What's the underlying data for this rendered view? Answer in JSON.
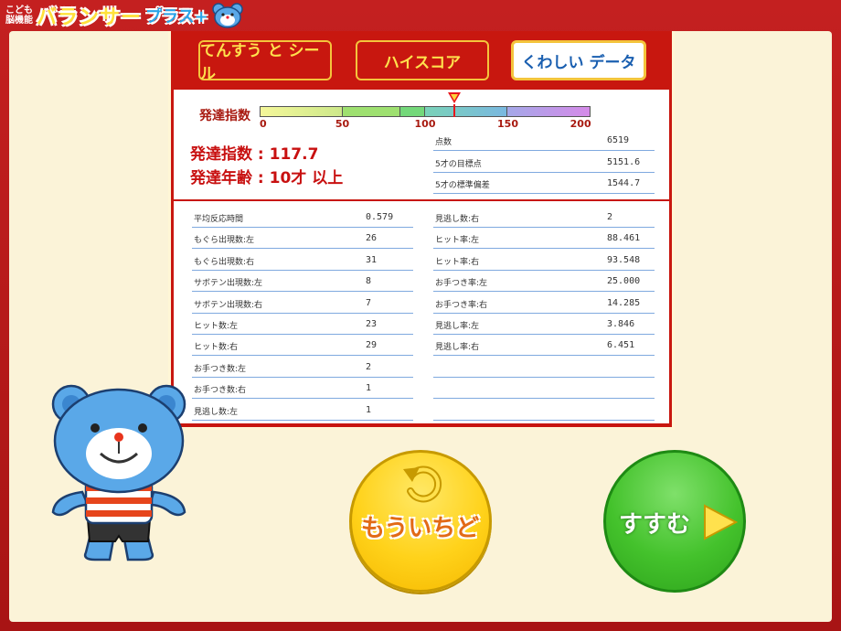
{
  "header": {
    "logo_small_line1": "こども",
    "logo_small_line2": "脳機能",
    "logo_title": "バランサー",
    "logo_plus": "プラス+"
  },
  "tabs": [
    {
      "label": "てんすう と シール",
      "active": false
    },
    {
      "label": "ハイスコア",
      "active": false
    },
    {
      "label": "くわしい データ",
      "active": true
    }
  ],
  "development": {
    "scale_label": "発達指数",
    "scale_ticks": [
      "0",
      "50",
      "100",
      "150",
      "200"
    ],
    "marker_value": 117.7,
    "dq_line": "発達指数 : 117.7",
    "age_line": "発達年齢 : 10才 以上"
  },
  "summary": [
    {
      "label": "点数",
      "value": "6519"
    },
    {
      "label": "5才の目標点",
      "value": "5151.6"
    },
    {
      "label": "5才の標準偏差",
      "value": "1544.7"
    }
  ],
  "stats_left": [
    {
      "label": "平均反応時間",
      "value": "0.579"
    },
    {
      "label": "もぐら出現数:左",
      "value": "26"
    },
    {
      "label": "もぐら出現数:右",
      "value": "31"
    },
    {
      "label": "サボテン出現数:左",
      "value": "8"
    },
    {
      "label": "サボテン出現数:右",
      "value": "7"
    },
    {
      "label": "ヒット数:左",
      "value": "23"
    },
    {
      "label": "ヒット数:右",
      "value": "29"
    },
    {
      "label": "お手つき数:左",
      "value": "2"
    },
    {
      "label": "お手つき数:右",
      "value": "1"
    },
    {
      "label": "見逃し数:左",
      "value": "1"
    }
  ],
  "stats_right": [
    {
      "label": "見逃し数:右",
      "value": "2"
    },
    {
      "label": "ヒット率:左",
      "value": "88.461"
    },
    {
      "label": "ヒット率:右",
      "value": "93.548"
    },
    {
      "label": "お手つき率:左",
      "value": "25.000"
    },
    {
      "label": "お手つき率:右",
      "value": "14.285"
    },
    {
      "label": "見逃し率:左",
      "value": "3.846"
    },
    {
      "label": "見逃し率:右",
      "value": "6.451"
    },
    {
      "label": "",
      "value": ""
    },
    {
      "label": "",
      "value": ""
    },
    {
      "label": "",
      "value": ""
    }
  ],
  "buttons": {
    "retry": "もういちど",
    "next": "すすむ"
  },
  "colors": {
    "frame_red": "#c8170f",
    "accent_yellow": "#f4c43c",
    "retry_yellow": "#ffd21a",
    "next_green": "#44c22c"
  }
}
